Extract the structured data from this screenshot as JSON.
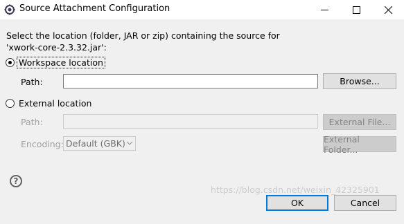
{
  "window": {
    "title": "Source Attachment Configuration",
    "minimize_glyph": "—",
    "maximize_glyph": "□",
    "close_glyph": "✕"
  },
  "message": {
    "line1": "Select the location (folder, JAR or zip) containing the source for",
    "line2": "'xwork-core-2.3.32.jar':"
  },
  "workspace": {
    "radio_label": "Workspace location",
    "selected": true,
    "path_label": "Path:",
    "path_value": "",
    "browse_label": "Browse..."
  },
  "external": {
    "radio_label": "External location",
    "selected": false,
    "path_label": "Path:",
    "path_value": "",
    "external_file_label": "External File...",
    "encoding_label": "Encoding:",
    "encoding_value": "Default (GBK)",
    "external_folder_label": "External Folder..."
  },
  "footer": {
    "help_glyph": "?",
    "ok_label": "OK",
    "cancel_label": "Cancel",
    "watermark": "https://blog.csdn.net/weixin_42325901"
  }
}
